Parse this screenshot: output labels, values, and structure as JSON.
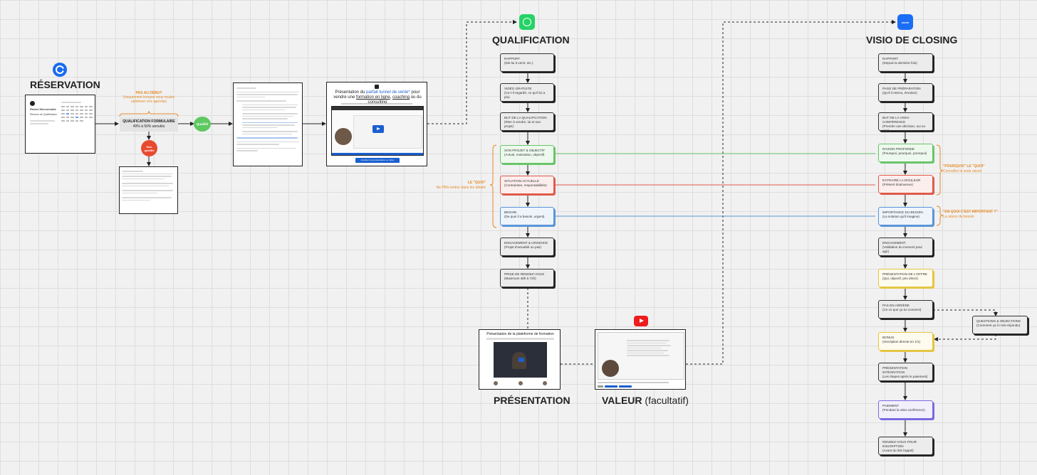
{
  "sections": {
    "reservation": "RÉSERVATION",
    "qualification": "QUALIFICATION",
    "visio_closing": "VISIO DE CLOSING",
    "presentation": "PRÉSENTATION",
    "valeur": "VALEUR",
    "valeur_suffix": "(facultatif)"
  },
  "form": {
    "note_title": "PAS AU DÉBUT",
    "note_sub_1": "Uniquement lorsque vous voulez",
    "note_sub_2": "optimiser vos agendas",
    "title": "QUALIFICATION FORMULAIRE",
    "subtitle": "40% à 50% annulés",
    "qualified": "Qualifié",
    "not_qualified_1": "Non",
    "not_qualified_2": "qualifié"
  },
  "calendar": {
    "name": "Ruben Mercoenatie",
    "event": "Réunion de Qualification"
  },
  "presentation_card": {
    "title_pre": "Présentation du",
    "title_link": "parfait tunnel de vente*",
    "title_mid": "pour vendre une",
    "link2": "formation en ligne",
    "link3": "coaching",
    "link4": "consulting",
    "button": "Accédez à la présentation en vidéo"
  },
  "platform_card": {
    "title": "Présentation de la plateforme de formation"
  },
  "qualification_nodes": [
    {
      "l1": "RAPPORT",
      "l2": "(Dis-lui à venir, etc.)",
      "color": "grey"
    },
    {
      "l1": "VIDÉO GRATUITE",
      "l2": "(Ce-t-il regardé, ce qu'il lui a plu)",
      "color": "grey"
    },
    {
      "l1": "BUT DE LA QUALIFICATION",
      "l2": "(Rien à vendre, lui et son projet)",
      "color": "grey"
    },
    {
      "l1": "SON PROJET & OBJECTIF",
      "l2": "(Actuel, motivation, objectif)",
      "color": "green"
    },
    {
      "l1": "SITUATION ACTUELLE",
      "l2": "(Contraintes, responsabilités)",
      "color": "red"
    },
    {
      "l1": "BESOIN",
      "l2": "(De quoi il a besoin, urgent)",
      "color": "blue"
    },
    {
      "l1": "ENGAGEMENT & URGENCE",
      "l2": "(Projet d'actualité ou pas)",
      "color": "grey"
    },
    {
      "l1": "PRISE DE RENDEZ-VOUS",
      "l2": "(Maximum 48h à 72h)",
      "color": "grey"
    }
  ],
  "closing_nodes": [
    {
      "l1": "RAPPORT",
      "l2": "(Depuis la dernière fois)",
      "color": "grey"
    },
    {
      "l1": "PAGE DE PRÉPARATION",
      "l2": "(Qu'il il retenu, émotion)",
      "color": "grey"
    },
    {
      "l1": "BUT DE LA VISIO-CONFÉRENCE",
      "l2": "(Prendre une décision, oui ou non)",
      "color": "grey"
    },
    {
      "l1": "RAISON PROFONDE",
      "l2": "(Pourquoi, pourquoi, pourquoi)",
      "color": "green"
    },
    {
      "l1": "EXTRAIRE LA DOULEUR",
      "l2": "(Présent douloureux)",
      "color": "red"
    },
    {
      "l1": "IMPORTANCE DU BESOIN",
      "l2": "(La solution qu'il imagine)",
      "color": "blue"
    },
    {
      "l1": "ENGAGEMENT",
      "l2": "(Validation du moment pour agir)",
      "color": "grey"
    },
    {
      "l1": "PRÉSENTATION DE L'OFFRE",
      "l2": "(Qui, objectif, prix direct)",
      "color": "yellow"
    },
    {
      "l1": "PAS EN ARRIÈRE",
      "l2": "(Ce ce que ça lui convient)",
      "color": "grey"
    },
    {
      "l1": "BONUS",
      "l2": "(Inscription directe en 1/1)",
      "color": "yellow"
    },
    {
      "l1": "PRÉSENTATION INTÉGRATION",
      "l2": "(Les étapes après le paiement)",
      "color": "grey"
    },
    {
      "l1": "PAIEMENT",
      "l2": "(Pendant la visio-conférence)",
      "color": "purple"
    },
    {
      "l1": "RENDEZ-VOUS POUR INSCRIPTION",
      "l2": "(Avant du link l'appel)",
      "color": "grey"
    }
  ],
  "objections_node": {
    "l1": "QUESTIONS & OBJECTIONS",
    "l2": "(Comment ça il n'est répondu)"
  },
  "annotations": {
    "quoi_title": "LE \"QUOI\"",
    "quoi_sub": "Ne PAS rentrer dans les détails",
    "pourquoi_title": "\"POURQUOI\" LE \"QUOI\"",
    "pourquoi_sub": "Connaître la vraie raison",
    "important_title": "\"EN QUOI C'EST IMPORTANT ?\"",
    "important_sub": "La raison du besoin"
  },
  "icons": {
    "calendly": "calendly-icon",
    "whatsapp": "whatsapp-icon",
    "zoom": "zoom-icon",
    "youtube": "youtube-icon",
    "zoom_label": "zoom"
  },
  "colors": {
    "orange": "#e58b2a",
    "green": "#6ac46a",
    "red": "#e05a4a",
    "blue": "#5a95d8",
    "whatsapp": "#25d366",
    "zoom": "#1c6df5",
    "youtube": "#ee1c1c"
  }
}
